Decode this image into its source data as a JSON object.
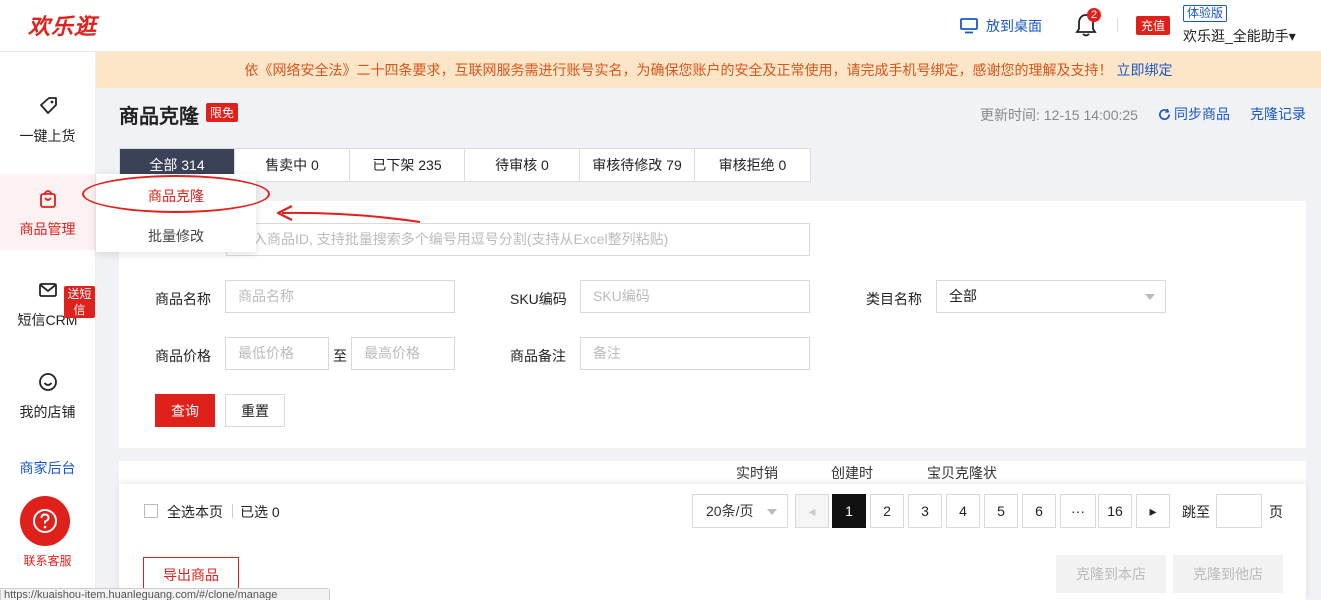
{
  "header": {
    "logo": "欢乐逛",
    "desktop_link": "放到桌面",
    "bell_count": "2",
    "recharge": "充值",
    "trial": "体验版",
    "account": "欢乐逛_全能助手▾"
  },
  "sidenav": {
    "items": [
      {
        "label": "一键上货",
        "icon": "tag-icon"
      },
      {
        "label": "商品管理",
        "icon": "shopping-bag-icon"
      },
      {
        "label": "短信CRM",
        "icon": "mail-icon",
        "badge": "送短信"
      },
      {
        "label": "我的店铺",
        "icon": "smile-icon"
      }
    ],
    "merchant": "商家后台",
    "help": "联系客服"
  },
  "notice": {
    "text": "依《网络安全法》二十四条要求，互联网服务需进行账号实名，为确保您账户的安全及正常使用，请完成手机号绑定，感谢您的理解及支持！",
    "bind": "立即绑定"
  },
  "page": {
    "title": "商品克隆",
    "free_badge": "限免",
    "update_time": "更新时间: 12-15 14:00:25",
    "sync": "同步商品",
    "clone_record": "克隆记录"
  },
  "tabs": [
    {
      "label": "全部 314",
      "active": true
    },
    {
      "label": "售卖中 0"
    },
    {
      "label": "已下架 235"
    },
    {
      "label": "待审核 0"
    },
    {
      "label": "审核待修改 79"
    },
    {
      "label": "审核拒绝 0"
    }
  ],
  "submenu": {
    "item1": "商品克隆",
    "item2": "批量修改"
  },
  "filter": {
    "id_placeholder": "输入商品ID, 支持批量搜索多个编号用逗号分割(支持从Excel整列粘贴)",
    "name_label": "商品名称",
    "name_placeholder": "商品名称",
    "sku_label": "SKU编码",
    "sku_placeholder": "SKU编码",
    "category_label": "类目名称",
    "category_value": "全部",
    "price_label": "商品价格",
    "price_min_placeholder": "最低价格",
    "price_to": "至",
    "price_max_placeholder": "最高价格",
    "remark_label": "商品备注",
    "remark_placeholder": "备注",
    "query": "查询",
    "reset": "重置"
  },
  "table": {
    "headers": [
      "实时销",
      "创建时",
      "宝贝克隆状"
    ]
  },
  "bottom": {
    "select_all": "全选本页",
    "selected": "已选 0",
    "per_page": "20条/页",
    "pages": [
      "1",
      "2",
      "3",
      "4",
      "5",
      "6",
      "···",
      "16"
    ],
    "current_page": "1",
    "jump_to": "跳至",
    "page_unit": "页",
    "export": "导出商品",
    "clone_this": "克隆到本店",
    "clone_other": "克隆到他店"
  },
  "status_url": "https://kuaishou-item.huanleguang.com/#/clone/manage",
  "colors": {
    "brand_red": "#e0201b",
    "link_blue": "#1a57c9",
    "notice_bg": "#fde5c7",
    "tab_active_bg": "#3b4257"
  }
}
